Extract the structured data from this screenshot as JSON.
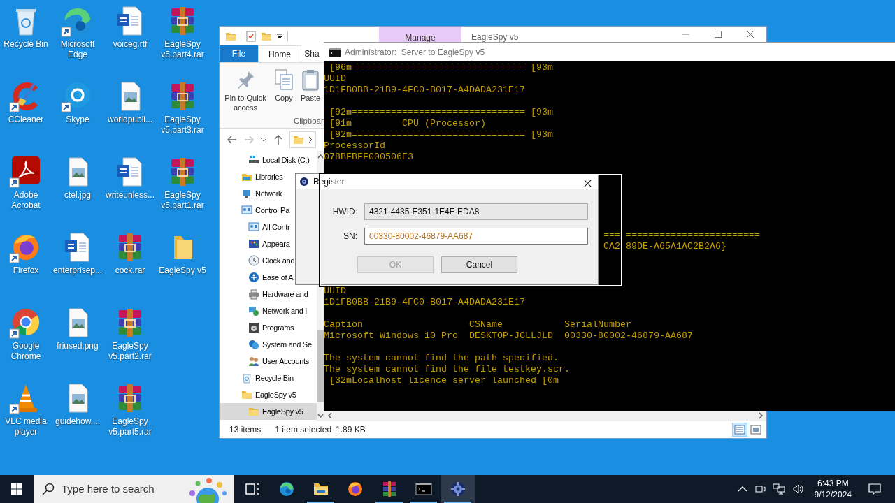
{
  "desktop_rows": [
    [
      {
        "label": "Recycle Bin",
        "kind": "recycle",
        "shortcut": false
      },
      {
        "label": "Microsoft Edge",
        "kind": "edge",
        "shortcut": true
      },
      {
        "label": "voiceg.rtf",
        "kind": "word",
        "shortcut": false
      },
      {
        "label": "EagleSpy v5.part4.rar",
        "kind": "rar",
        "shortcut": false
      }
    ],
    [
      {
        "label": "CCleaner",
        "kind": "ccleaner",
        "shortcut": true
      },
      {
        "label": "Skype",
        "kind": "skype",
        "shortcut": true
      },
      {
        "label": "worldpubli...",
        "kind": "image",
        "shortcut": false
      },
      {
        "label": "EagleSpy v5.part3.rar",
        "kind": "rar",
        "shortcut": false
      }
    ],
    [
      {
        "label": "Adobe Acrobat",
        "kind": "acrobat",
        "shortcut": true
      },
      {
        "label": "ctel.jpg",
        "kind": "image",
        "shortcut": false
      },
      {
        "label": "writeunless...",
        "kind": "word",
        "shortcut": false
      },
      {
        "label": "EagleSpy v5.part1.rar",
        "kind": "rar",
        "shortcut": false
      }
    ],
    [
      {
        "label": "Firefox",
        "kind": "firefox",
        "shortcut": true
      },
      {
        "label": "enterprisep...",
        "kind": "word",
        "shortcut": false
      },
      {
        "label": "cock.rar",
        "kind": "rar",
        "shortcut": false
      },
      {
        "label": "EagleSpy v5",
        "kind": "folder",
        "shortcut": false
      }
    ],
    [
      {
        "label": "Google Chrome",
        "kind": "chrome",
        "shortcut": true
      },
      {
        "label": "friused.png",
        "kind": "image",
        "shortcut": false
      },
      {
        "label": "EagleSpy v5.part2.rar",
        "kind": "rar",
        "shortcut": false
      }
    ],
    [
      {
        "label": "VLC media player",
        "kind": "vlc",
        "shortcut": true
      },
      {
        "label": "guidehow....",
        "kind": "image",
        "shortcut": false
      },
      {
        "label": "EagleSpy v5.part5.rar",
        "kind": "rar",
        "shortcut": false
      }
    ]
  ],
  "explorer": {
    "context_tab": "Manage",
    "title": "EagleSpy v5",
    "ribbon_tabs": [
      {
        "label": "File",
        "kind": "file",
        "selected": false
      },
      {
        "label": "Home",
        "kind": "tab",
        "selected": true
      },
      {
        "label": "Sha",
        "kind": "tab",
        "selected": false
      }
    ],
    "ribbon_buttons": [
      {
        "label": "Pin to Quick access",
        "kind": "pin"
      },
      {
        "label": "Copy",
        "kind": "copy"
      },
      {
        "label": "Paste",
        "kind": "paste"
      }
    ],
    "ribbon_group": "Clipboar",
    "nav_pane": {
      "continued_items": [
        {
          "label": "Local Disk (C:)",
          "kind": "drive",
          "selected": false
        }
      ],
      "items": [
        {
          "label": "Libraries",
          "kind": "libraries",
          "selected": false
        },
        {
          "label": "Network",
          "kind": "network",
          "selected": false
        },
        {
          "label": "Control Pa",
          "kind": "control",
          "selected": false,
          "children": [
            {
              "label": "All Contr",
              "kind": "control",
              "selected": false
            },
            {
              "label": "Appeara",
              "kind": "appearance",
              "selected": false
            },
            {
              "label": "Clock and",
              "kind": "clock",
              "selected": false
            },
            {
              "label": "Ease of A",
              "kind": "ease",
              "selected": false
            },
            {
              "label": "Hardware and",
              "kind": "hardware",
              "selected": false
            },
            {
              "label": "Network and I",
              "kind": "netint",
              "selected": false
            },
            {
              "label": "Programs",
              "kind": "programs",
              "selected": false
            },
            {
              "label": "System and Se",
              "kind": "system",
              "selected": false
            },
            {
              "label": "User Accounts",
              "kind": "users",
              "selected": false
            }
          ]
        },
        {
          "label": "Recycle Bin",
          "kind": "recycle",
          "selected": false
        },
        {
          "label": "EagleSpy v5",
          "kind": "folder",
          "selected": false,
          "children": [
            {
              "label": "EagleSpy v5",
              "kind": "folder",
              "selected": true
            }
          ]
        }
      ]
    },
    "status": {
      "item_count": "13 items",
      "selection": "1 item selected",
      "size": "1.89 KB"
    },
    "views": [
      {
        "kind": "details",
        "selected": true
      },
      {
        "kind": "large_icons",
        "selected": false
      }
    ]
  },
  "console": {
    "title": "Administrator:  Server to EagleSpy v5",
    "lines": [
      {
        "kind": "text",
        "text": " [96m=============================== [93m"
      },
      {
        "kind": "text",
        "text": "UUID"
      },
      {
        "kind": "text",
        "text": "1D1FB0BB-21B9-4FC0-B017-A4DADA231E17"
      },
      {
        "kind": "blank"
      },
      {
        "kind": "text",
        "text": " [92m=============================== [93m"
      },
      {
        "kind": "text",
        "text": " [91m         CPU (Processor)"
      },
      {
        "kind": "text",
        "text": " [92m=============================== [93m"
      },
      {
        "kind": "text",
        "text": "ProcessorId"
      },
      {
        "kind": "text",
        "text": "078BFBFF000506E3"
      },
      {
        "kind": "blank"
      },
      {
        "kind": "blank"
      },
      {
        "kind": "blank"
      },
      {
        "kind": "blank"
      },
      {
        "kind": "blank"
      },
      {
        "kind": "blank"
      },
      {
        "kind": "text",
        "text": "                                                  === ========================"
      },
      {
        "kind": "text",
        "text": "                                                  CA2 89DE-A65A1AC2B2A6}"
      },
      {
        "kind": "blank"
      },
      {
        "kind": "blank"
      },
      {
        "kind": "blank"
      },
      {
        "kind": "text",
        "text": "UUID"
      },
      {
        "kind": "text",
        "text": "1D1FB0BB-21B9-4FC0-B017-A4DADA231E17"
      },
      {
        "kind": "blank"
      },
      {
        "kind": "text",
        "text": "Caption                   CSName           SerialNumber"
      },
      {
        "kind": "text",
        "text": "Microsoft Windows 10 Pro  DESKTOP-JGLLJLD  00330-80002-46879-AA687"
      },
      {
        "kind": "blank"
      },
      {
        "kind": "text",
        "text": "The system cannot find the path specified."
      },
      {
        "kind": "text",
        "text": "The system cannot find the file testkey.scr."
      },
      {
        "kind": "text",
        "text": " [32mLocalhost licence server launched [0m"
      }
    ]
  },
  "dialog": {
    "title": "Register",
    "fields": [
      {
        "label": "HWID:",
        "value": "4321-4435-E351-1E4F-EDA8",
        "readonly": true
      },
      {
        "label": "SN:",
        "value": "00330-80002-46879-AA687",
        "readonly": false
      }
    ],
    "buttons": [
      {
        "label": "OK",
        "disabled": true
      },
      {
        "label": "Cancel",
        "disabled": false
      }
    ]
  },
  "taskbar": {
    "search_placeholder": "Type here to search",
    "apps": [
      {
        "kind": "taskview",
        "running": false,
        "active": false
      },
      {
        "kind": "edge",
        "running": false,
        "active": false
      },
      {
        "kind": "explorer",
        "running": true,
        "active": false
      },
      {
        "kind": "firefox",
        "running": false,
        "active": false
      },
      {
        "kind": "winrar",
        "running": true,
        "active": false
      },
      {
        "kind": "cmd",
        "running": true,
        "active": false
      },
      {
        "kind": "eaglespy",
        "running": true,
        "active": true
      }
    ],
    "clock": {
      "time": "6:43 PM",
      "date": "9/12/2024"
    }
  }
}
